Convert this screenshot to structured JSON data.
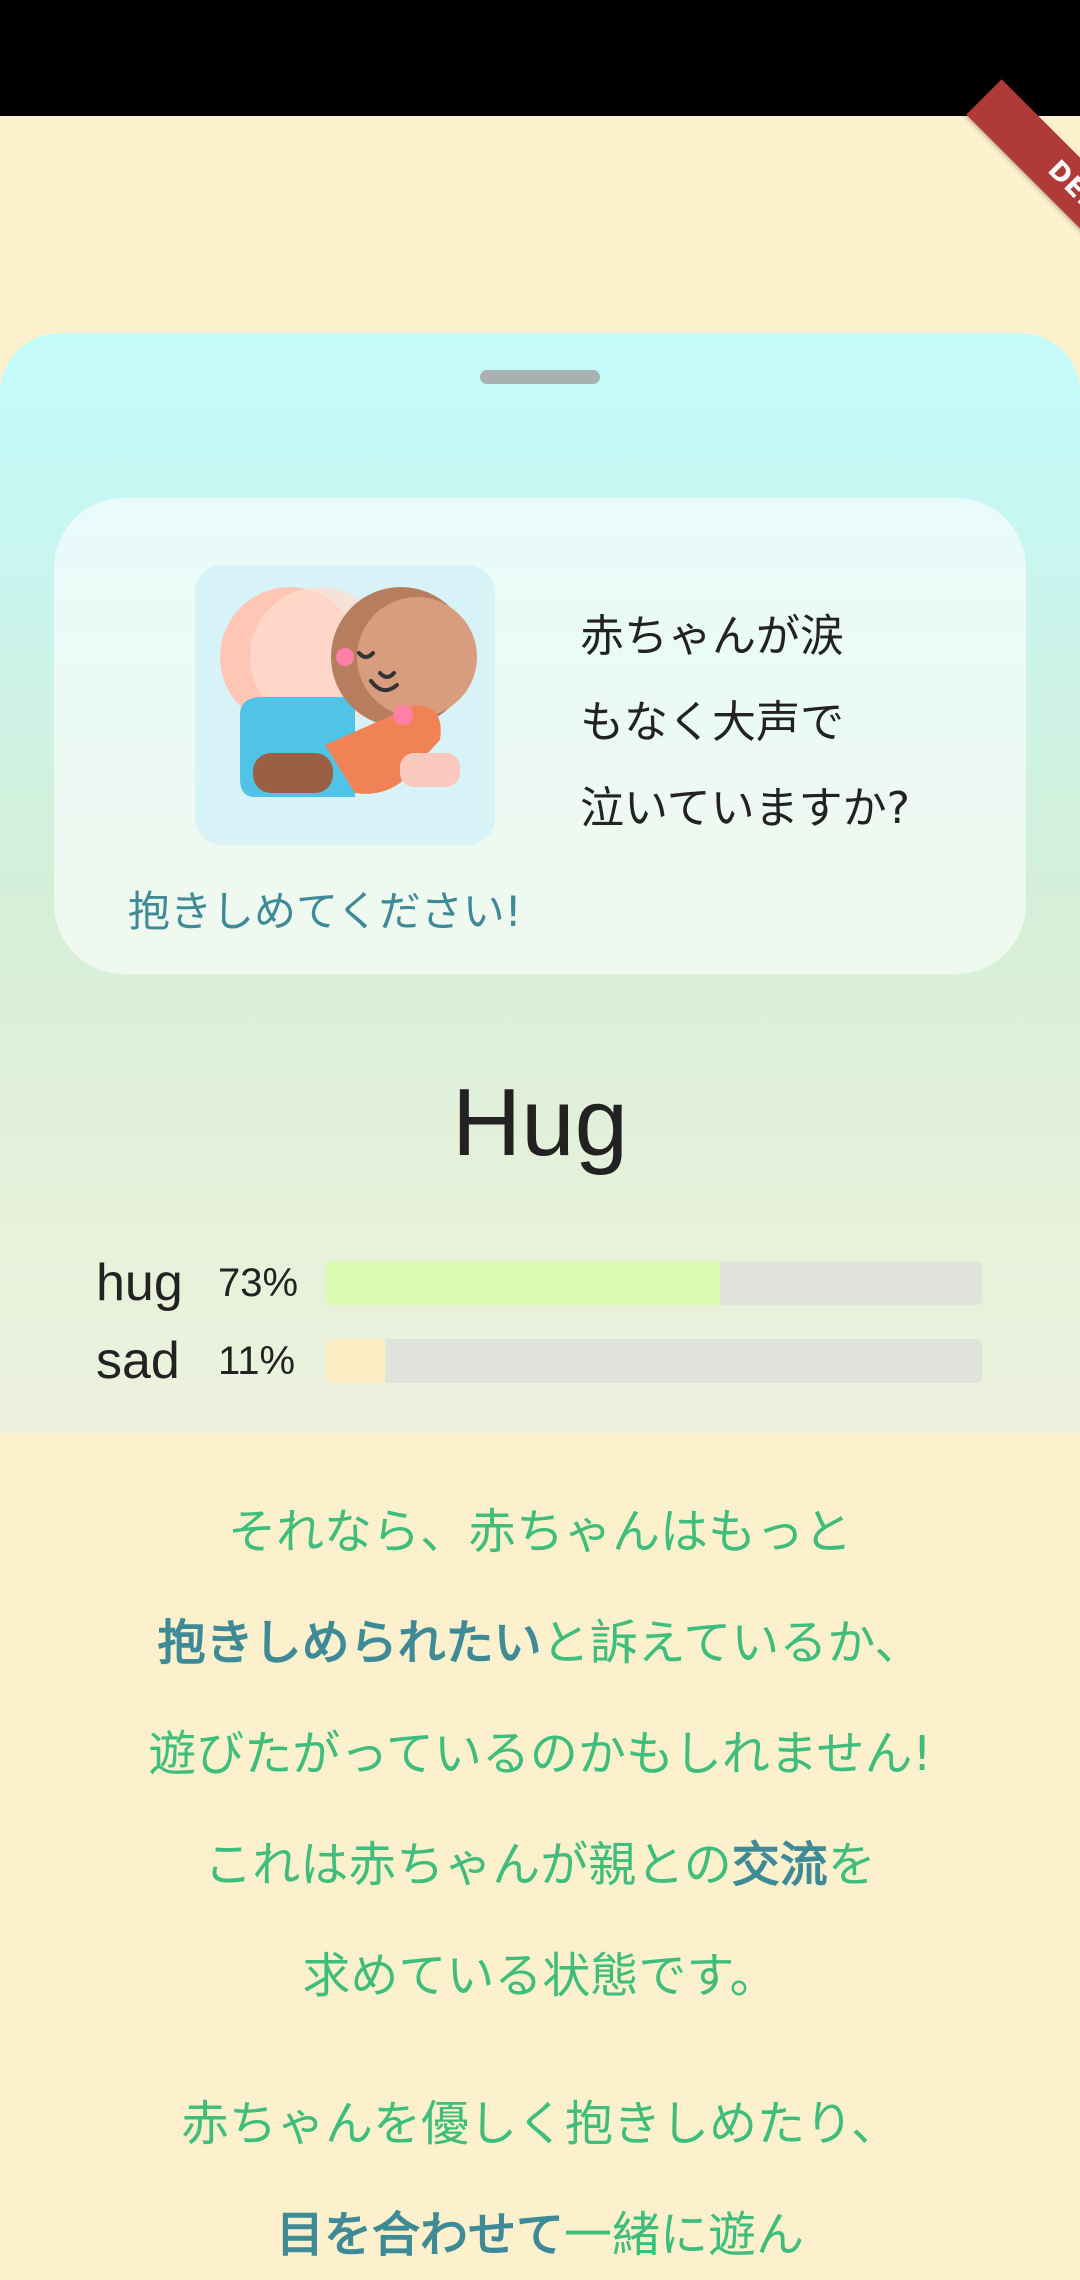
{
  "debug_banner": "DEBUG",
  "card": {
    "question_lines": [
      "赤ちゃんが涙",
      "もなく大声で",
      "泣いていますか?"
    ],
    "caption": "抱きしめてください!"
  },
  "result": {
    "title": "Hug",
    "bars": [
      {
        "label": "hug",
        "percent_text": "73%",
        "fill_fraction": 0.6,
        "color": "#dafcb0"
      },
      {
        "label": "sad",
        "percent_text": "11%",
        "fill_fraction": 0.09,
        "color": "#fdeec4"
      }
    ]
  },
  "message": {
    "line1": "それなら、赤ちゃんはもっと",
    "line2_bold": "抱きしめられたい",
    "line2_rest": "と訴えているか、",
    "line3": "遊びたがっているのかもしれません!",
    "line4_pre": "これは赤ちゃんが親との",
    "line4_bold": "交流",
    "line4_post": "を",
    "line5": "求めている状態です。",
    "line6": "赤ちゃんを優しく抱きしめたり、",
    "line7_bold": "目を合わせて",
    "line7_rest": "一緒に遊ん"
  },
  "colors": {
    "accent_green": "#3fbd7c",
    "accent_teal": "#3f8a97"
  }
}
